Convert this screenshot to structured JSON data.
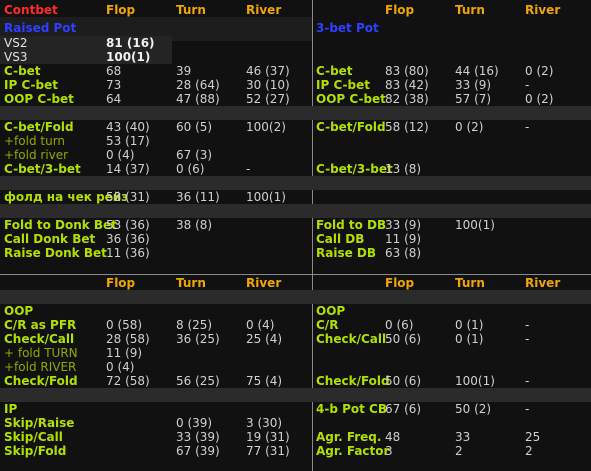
{
  "top": {
    "title": "Contbet",
    "col_flop": "Flop",
    "col_turn": "Turn",
    "col_river": "River",
    "left": {
      "section": "Raised Pot",
      "vs2_label": "VS2",
      "vs2_value": "81 (16)",
      "vs3_label": "VS3",
      "vs3_value": "100(1)",
      "rows1": [
        {
          "label": "C-bet",
          "flop": "68",
          "turn": "39",
          "river": "46 (37)"
        },
        {
          "label": "IP C-bet",
          "flop": "73",
          "turn": "28 (64)",
          "river": "30 (10)"
        },
        {
          "label": "OOP C-bet",
          "flop": "64",
          "turn": "47 (88)",
          "river": "52 (27)"
        }
      ],
      "cbet_fold": {
        "label": "C-bet/Fold",
        "flop": "43 (40)",
        "turn": "60 (5)",
        "river": "100(2)"
      },
      "fold_turn": {
        "label": "+fold turn",
        "flop": "53 (17)"
      },
      "fold_river": {
        "label": "+fold river",
        "flop": "0 (4)",
        "turn": "67 (3)"
      },
      "cbet_3bet": {
        "label": "C-bet/3-bet",
        "flop": "14 (37)",
        "turn": "0 (6)",
        "river": "-"
      },
      "fold_checkraise": {
        "label": "фолд на чек рейз",
        "flop": "58 (31)",
        "turn": "36 (11)",
        "river": "100(1)"
      },
      "donk": [
        {
          "label": "Fold to Donk Bet",
          "flop": "53 (36)",
          "turn": "38 (8)"
        },
        {
          "label": "Call Donk Bet",
          "flop": "36 (36)"
        },
        {
          "label": "Raise Donk Bet",
          "flop": "11 (36)"
        }
      ]
    },
    "right": {
      "col_flop": "Flop",
      "col_turn": "Turn",
      "col_river": "River",
      "section": "3-bet Pot",
      "rows1": [
        {
          "label": "C-bet",
          "flop": "83 (80)",
          "turn": "44 (16)",
          "river": "0 (2)"
        },
        {
          "label": "IP C-bet",
          "flop": "83 (42)",
          "turn": "33 (9)",
          "river": "-"
        },
        {
          "label": "OOP C-bet",
          "flop": "82 (38)",
          "turn": "57 (7)",
          "river": "0 (2)"
        }
      ],
      "cbet_fold": {
        "label": "C-bet/Fold",
        "flop": "58 (12)",
        "turn": "0 (2)",
        "river": "-"
      },
      "cbet_3bet": {
        "label": "C-bet/3-bet",
        "flop": "13 (8)"
      },
      "db": [
        {
          "label": "Fold to DB",
          "flop": "33 (9)",
          "turn": "100(1)"
        },
        {
          "label": "Call DB",
          "flop": "11 (9)"
        },
        {
          "label": "Raise DB",
          "flop": "63 (8)"
        }
      ]
    }
  },
  "bottom": {
    "left": {
      "col_flop": "Flop",
      "col_turn": "Turn",
      "col_river": "River",
      "oop": "OOP",
      "oop_rows": [
        {
          "label": "C/R as PFR",
          "flop": "0 (58)",
          "turn": "8 (25)",
          "river": "0 (4)"
        },
        {
          "label": "Check/Call",
          "flop": "28 (58)",
          "turn": "36 (25)",
          "river": "25 (4)"
        }
      ],
      "fold_turn": {
        "label": "+ fold TURN",
        "flop": "11 (9)"
      },
      "fold_river": {
        "label": "+fold RIVER",
        "flop": "0 (4)"
      },
      "check_fold": {
        "label": "Check/Fold",
        "flop": "72 (58)",
        "turn": "56 (25)",
        "river": "75 (4)"
      },
      "ip": "IP",
      "ip_rows": [
        {
          "label": "Skip/Raise",
          "flop": "",
          "turn": "0 (39)",
          "river": "3 (30)"
        },
        {
          "label": "Skip/Call",
          "flop": "",
          "turn": "33 (39)",
          "river": "19 (31)"
        },
        {
          "label": "Skip/Fold",
          "flop": "",
          "turn": "67 (39)",
          "river": "77 (31)"
        }
      ]
    },
    "right": {
      "col_flop": "Flop",
      "col_turn": "Turn",
      "col_river": "River",
      "oop": "OOP",
      "oop_rows": [
        {
          "label": "C/R",
          "flop": "0 (6)",
          "turn": "0 (1)",
          "river": "-"
        },
        {
          "label": "Check/Call",
          "flop": "50 (6)",
          "turn": "0 (1)",
          "river": "-"
        }
      ],
      "check_fold": {
        "label": "Check/Fold",
        "flop": "50 (6)",
        "turn": "100(1)",
        "river": "-"
      },
      "pot4b": {
        "label": "4-b Pot CB",
        "flop": "67 (6)",
        "turn": "50 (2)",
        "river": "-"
      },
      "agr_freq": {
        "label": "Agr. Freq.",
        "flop": "48",
        "turn": "33",
        "river": "25"
      },
      "agr_factor": {
        "label": "Agr. Factor",
        "flop": "3",
        "turn": "2",
        "river": "2"
      }
    }
  }
}
